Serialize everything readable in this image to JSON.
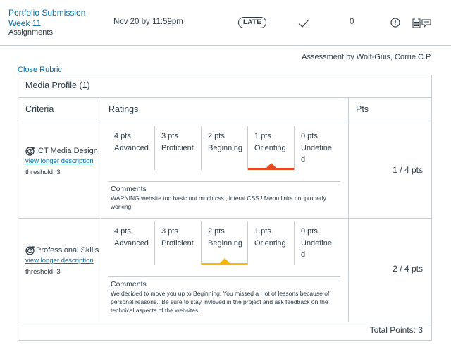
{
  "assignment": {
    "title": "Portfolio Submission Week 11",
    "type": "Assignments",
    "due": "Nov 20 by 11:59pm",
    "status_badge": "LATE",
    "score": "0",
    "icons": [
      "check-icon",
      "alert-icon",
      "rubric-icon"
    ]
  },
  "assessment_by": "Assessment by Wolf-Guis, Corrie C.P.",
  "close_rubric": "Close Rubric",
  "rubric": {
    "title": "Media Profile (1)",
    "headers": {
      "criteria": "Criteria",
      "ratings": "Ratings",
      "pts": "Pts"
    },
    "criteria": [
      {
        "name": "ICT Media Design",
        "link": "view longer description",
        "threshold": "threshold: 3",
        "ratings": [
          {
            "pts": "4 pts",
            "desc": "Advanced"
          },
          {
            "pts": "3 pts",
            "desc": "Proficient"
          },
          {
            "pts": "2 pts",
            "desc": "Beginning"
          },
          {
            "pts": "1 pts",
            "desc": "Orienting"
          },
          {
            "pts": "0 pts",
            "desc": "Undefined"
          }
        ],
        "selected_index": 3,
        "selected_color": "#e8491d",
        "comments_label": "Comments",
        "comment": "WARNING website too basic not much css , interal CSS ! Menu links not properly working",
        "points": "1 / 4 pts"
      },
      {
        "name": "Professional Skills",
        "link": "view longer description",
        "threshold": "threshold: 3",
        "ratings": [
          {
            "pts": "4 pts",
            "desc": "Advanced"
          },
          {
            "pts": "3 pts",
            "desc": "Proficient"
          },
          {
            "pts": "2 pts",
            "desc": "Beginning"
          },
          {
            "pts": "1 pts",
            "desc": "Orienting"
          },
          {
            "pts": "0 pts",
            "desc": "Undefined"
          }
        ],
        "selected_index": 2,
        "selected_color": "#f5b800",
        "comments_label": "Comments",
        "comment": "We decided to move you up to Beginning: You missed a l lot of lessons because of personal reasons.. Be sure to stay invloved in the project and ask feedback on the technical aspects of the websites",
        "points": "2 / 4 pts"
      }
    ],
    "total": "Total Points: 3"
  },
  "colors": {
    "link": "#0770a3",
    "text": "#2d3b45",
    "border": "#c7cdd1"
  }
}
